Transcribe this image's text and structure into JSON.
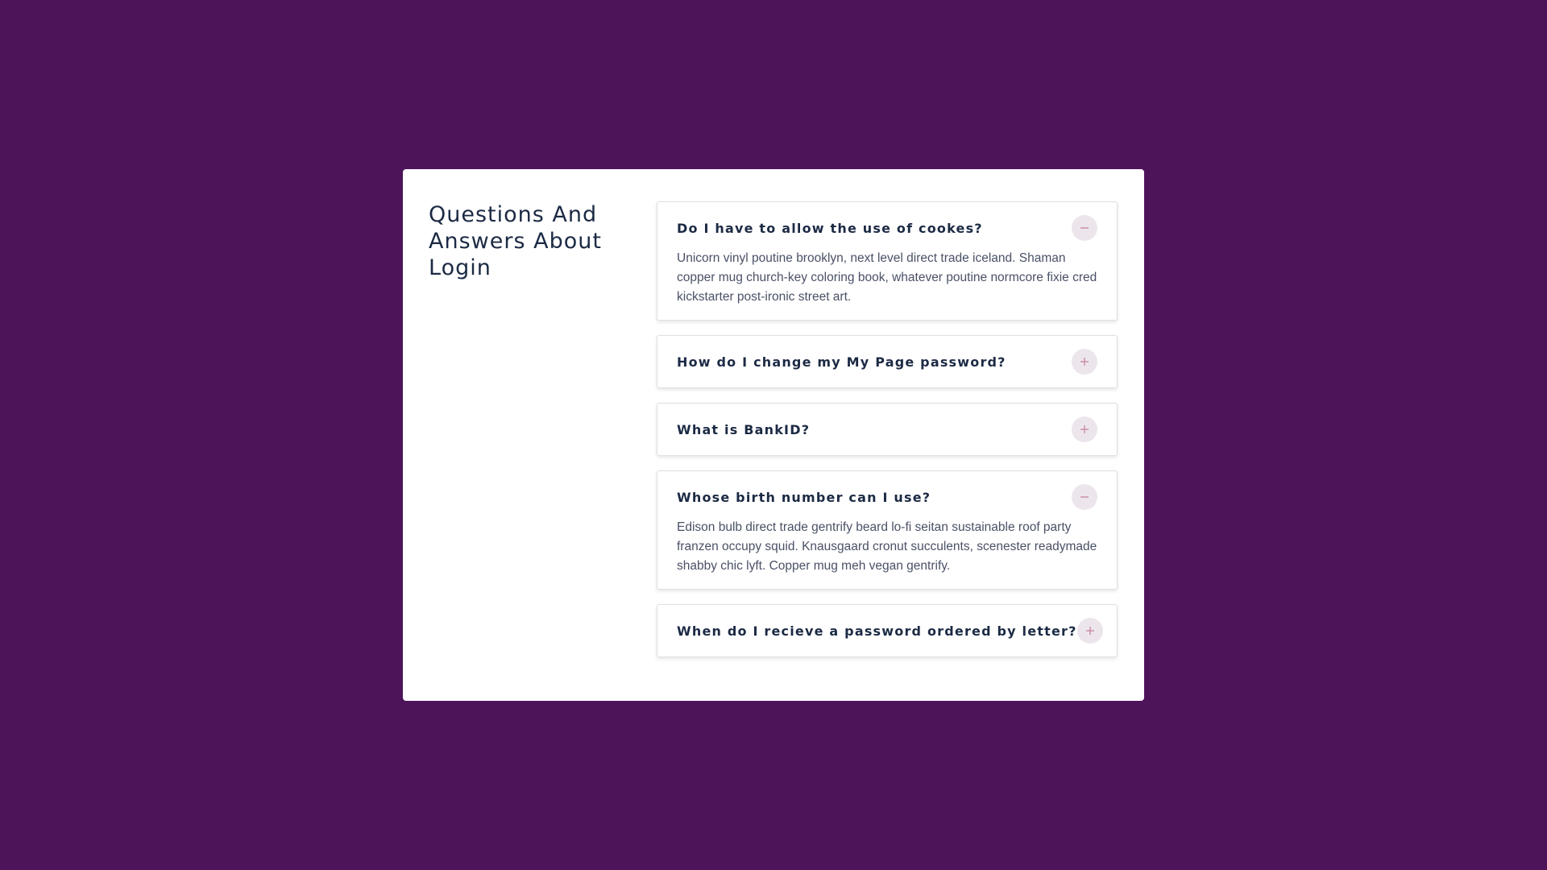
{
  "page": {
    "title": "Questions And Answers About Login"
  },
  "colors": {
    "background": "#4e145a",
    "card": "#ffffff",
    "heading": "#1c2a44",
    "answer_text": "#4a5166",
    "toggle_bg": "#ece6ec",
    "toggle_icon": "#c98aa3"
  },
  "faq": {
    "items": [
      {
        "question": "Do I have to allow the use of cookes?",
        "answer": "Unicorn vinyl poutine brooklyn, next level direct trade iceland. Shaman copper mug church-key coloring book, whatever poutine normcore fixie cred kickstarter post-ironic street art.",
        "expanded": true,
        "icon": "minus-icon"
      },
      {
        "question": "How do I change my My Page password?",
        "expanded": false,
        "icon": "plus-icon"
      },
      {
        "question": "What is BankID?",
        "expanded": false,
        "icon": "plus-icon"
      },
      {
        "question": "Whose birth number can I use?",
        "answer": "Edison bulb direct trade gentrify beard lo-fi seitan sustainable roof party franzen occupy squid. Knausgaard cronut succulents, scenester readymade shabby chic lyft. Copper mug meh vegan gentrify.",
        "expanded": true,
        "icon": "minus-icon"
      },
      {
        "question": "When do I recieve a password ordered by letter?",
        "expanded": false,
        "icon": "plus-icon"
      }
    ]
  }
}
